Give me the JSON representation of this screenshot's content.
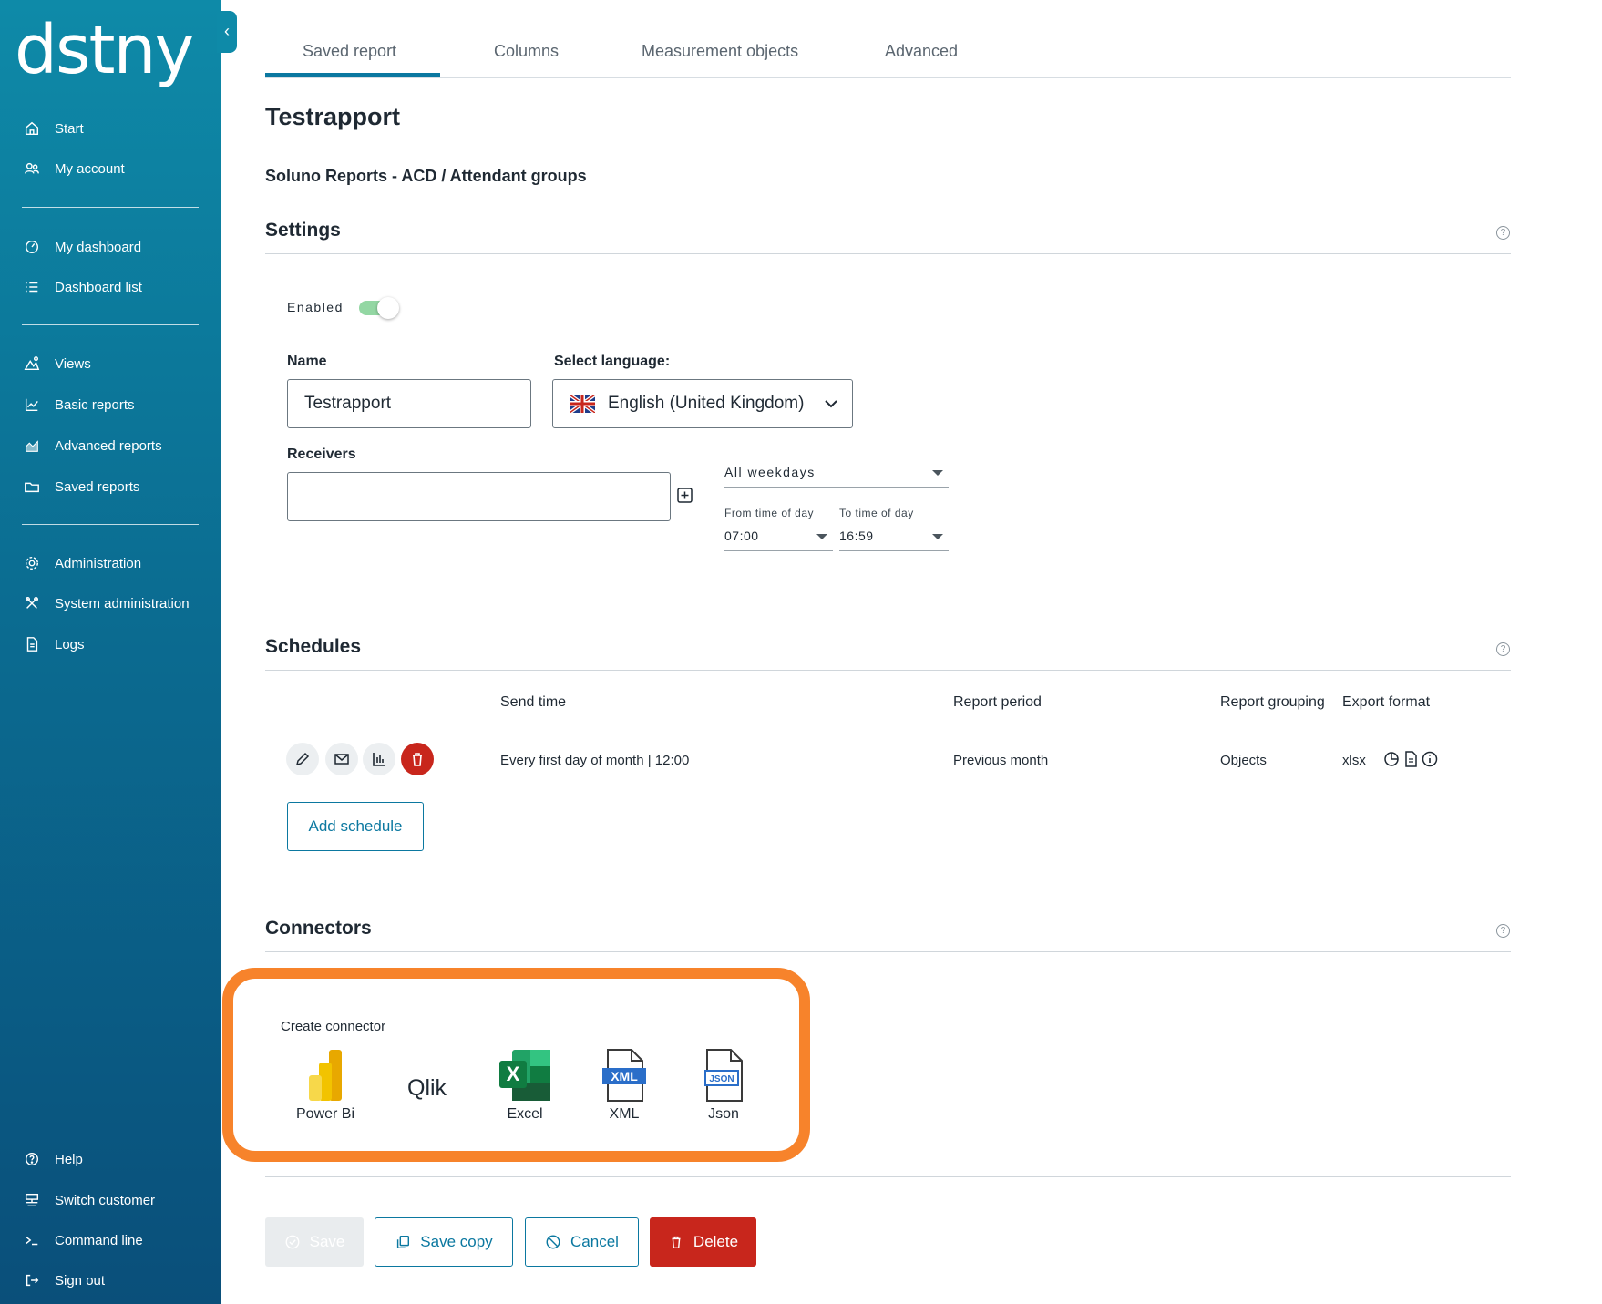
{
  "brand": {
    "logo_text": "dstny",
    "accent": "#0b78a0",
    "danger": "#c8261c",
    "highlight": "#f7832b"
  },
  "sidebar": {
    "collapse_glyph": "‹",
    "items": [
      {
        "label": "Start",
        "icon": "home-icon"
      },
      {
        "label": "My account",
        "icon": "users-icon"
      },
      {
        "label": "My dashboard",
        "icon": "gauge-icon"
      },
      {
        "label": "Dashboard list",
        "icon": "list-icon"
      },
      {
        "label": "Views",
        "icon": "views-icon"
      },
      {
        "label": "Basic reports",
        "icon": "line-chart-icon"
      },
      {
        "label": "Advanced reports",
        "icon": "area-chart-icon"
      },
      {
        "label": "Saved reports",
        "icon": "folder-icon"
      },
      {
        "label": "Administration",
        "icon": "gear-icon"
      },
      {
        "label": "System administration",
        "icon": "tools-icon"
      },
      {
        "label": "Logs",
        "icon": "document-icon"
      }
    ],
    "bottom_items": [
      {
        "label": "Help",
        "icon": "help-icon"
      },
      {
        "label": "Switch customer",
        "icon": "switch-icon"
      },
      {
        "label": "Command line",
        "icon": "terminal-icon"
      },
      {
        "label": "Sign out",
        "icon": "sign-out-icon"
      }
    ]
  },
  "tabs": [
    {
      "label": "Saved report",
      "active": true
    },
    {
      "label": "Columns",
      "active": false
    },
    {
      "label": "Measurement objects",
      "active": false
    },
    {
      "label": "Advanced",
      "active": false
    }
  ],
  "page": {
    "title": "Testrapport",
    "subtitle": "Soluno Reports - ACD / Attendant groups"
  },
  "settings": {
    "title": "Settings",
    "help_glyph": "?",
    "enabled_label": "Enabled",
    "enabled": true,
    "name_label": "Name",
    "name_value": "Testrapport",
    "language_label": "Select language:",
    "language_value": "English (United Kingdom)",
    "receivers_label": "Receivers",
    "receivers_value": "",
    "weekdays_value": "All weekdays",
    "from_time_label": "From time of day",
    "from_time_value": "07:00",
    "to_time_label": "To time of day",
    "to_time_value": "16:59"
  },
  "schedules": {
    "title": "Schedules",
    "help_glyph": "?",
    "columns": [
      "Send time",
      "Report period",
      "Report grouping",
      "Export format"
    ],
    "rows": [
      {
        "send_time": "Every first day of month | 12:00",
        "report_period": "Previous month",
        "report_grouping": "Objects",
        "export_format": "xlsx"
      }
    ],
    "add_label": "Add schedule"
  },
  "connectors": {
    "title": "Connectors",
    "help_glyph": "?",
    "create_label": "Create connector",
    "items": [
      {
        "label": "Power Bi",
        "icon": "power-bi-icon"
      },
      {
        "label": "Qlik",
        "icon": "qlik-logo"
      },
      {
        "label": "Excel",
        "icon": "excel-icon"
      },
      {
        "label": "XML",
        "icon": "xml-icon"
      },
      {
        "label": "Json",
        "icon": "json-icon"
      }
    ],
    "excel_glyph": "X",
    "xml_glyph": "XML",
    "json_glyph": "JSON"
  },
  "actions": {
    "save": "Save",
    "save_copy": "Save copy",
    "cancel": "Cancel",
    "delete": "Delete"
  }
}
